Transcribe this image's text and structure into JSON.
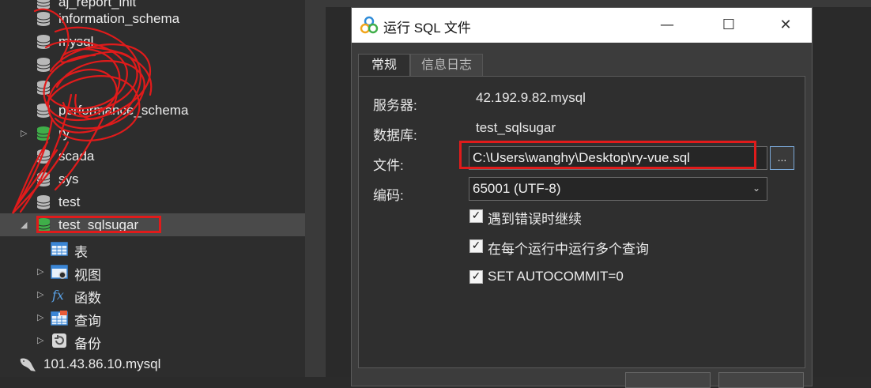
{
  "navigator": {
    "rows": [
      {
        "label": "aj_report_init",
        "icon": "database-icon-gray"
      },
      {
        "label": "information_schema",
        "icon": "database-icon-gray"
      },
      {
        "label": "mysql",
        "icon": "database-icon-gray"
      },
      {
        "label": "",
        "icon": "database-icon-gray"
      },
      {
        "label": "",
        "icon": "database-icon-gray"
      },
      {
        "label": "performance_schema",
        "icon": "database-icon-gray"
      },
      {
        "label": "ry",
        "icon": "database-icon-green"
      },
      {
        "label": "scada",
        "icon": "database-icon-gray"
      },
      {
        "label": "sys",
        "icon": "database-icon-gray"
      },
      {
        "label": "test",
        "icon": "database-icon-gray"
      },
      {
        "label": "test_sqlsugar",
        "icon": "database-icon-green"
      }
    ],
    "children": [
      {
        "label": "表",
        "icon": "table-icon"
      },
      {
        "label": "视图",
        "icon": "view-icon"
      },
      {
        "label": "函数",
        "icon": "function-icon"
      },
      {
        "label": "查询",
        "icon": "query-icon"
      },
      {
        "label": "备份",
        "icon": "backup-icon"
      }
    ],
    "connection": {
      "label": "101.43.86.10.mysql",
      "icon": "mysql-dolphin-icon"
    }
  },
  "dialog": {
    "title": "运行 SQL 文件",
    "tabs": [
      "常规",
      "信息日志"
    ],
    "server_label": "服务器:",
    "server_value": "42.192.9.82.mysql",
    "database_label": "数据库:",
    "database_value": "test_sqlsugar",
    "file_label": "文件:",
    "file_value": "C:\\Users\\wanghy\\Desktop\\ry-vue.sql",
    "browse_label": "...",
    "encoding_label": "编码:",
    "encoding_value": "65001 (UTF-8)",
    "checkboxes": [
      {
        "label": "遇到错误时继续",
        "checked": true
      },
      {
        "label": "在每个运行中运行多个查询",
        "checked": true
      },
      {
        "label": "SET AUTOCOMMIT=0",
        "checked": true
      }
    ]
  },
  "colors": {
    "highlight_red": "#e01b1b",
    "db_green": "#3fae49",
    "db_gray": "#b9b9b9"
  }
}
